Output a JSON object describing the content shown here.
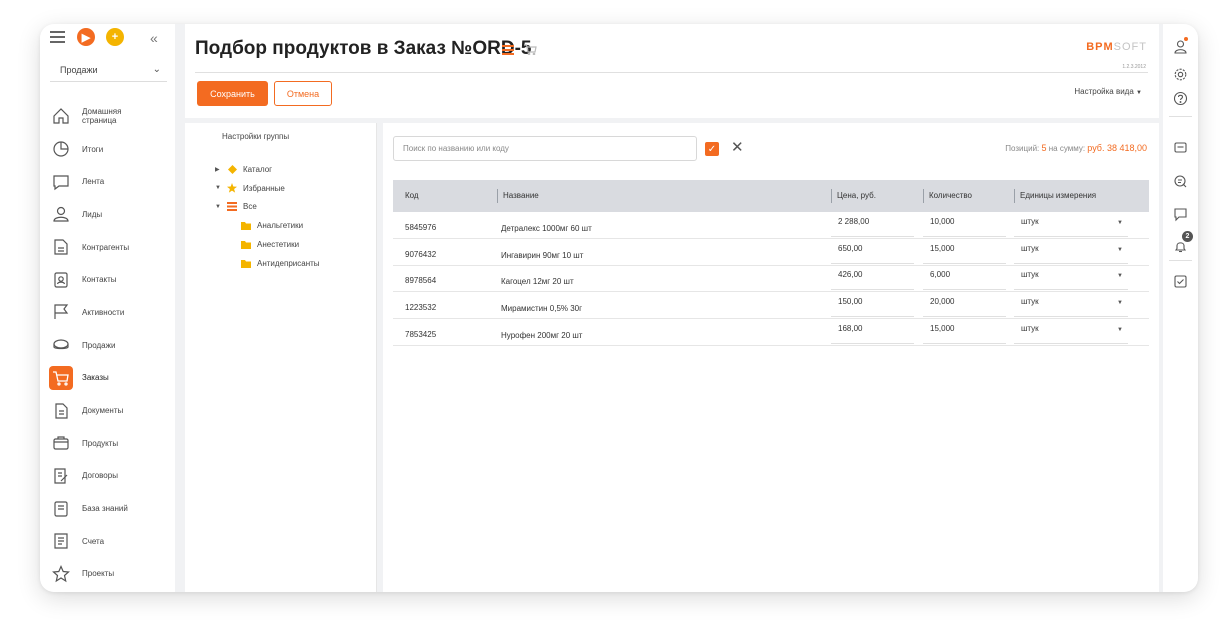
{
  "sidebar": {
    "workspace": "Продажи",
    "items": [
      {
        "label": "Домашняя страница",
        "icon": "home-icon"
      },
      {
        "label": "Итоги",
        "icon": "pie-chart-icon"
      },
      {
        "label": "Лента",
        "icon": "feed-icon"
      },
      {
        "label": "Лиды",
        "icon": "leads-icon"
      },
      {
        "label": "Контрагенты",
        "icon": "accounts-icon"
      },
      {
        "label": "Контакты",
        "icon": "contacts-icon"
      },
      {
        "label": "Активности",
        "icon": "flag-icon"
      },
      {
        "label": "Продажи",
        "icon": "opportunities-icon"
      },
      {
        "label": "Заказы",
        "icon": "cart-icon"
      },
      {
        "label": "Документы",
        "icon": "documents-icon"
      },
      {
        "label": "Продукты",
        "icon": "products-icon"
      },
      {
        "label": "Договоры",
        "icon": "contracts-icon"
      },
      {
        "label": "База знаний",
        "icon": "knowledge-base-icon"
      },
      {
        "label": "Счета",
        "icon": "invoices-icon"
      },
      {
        "label": "Проекты",
        "icon": "star-icon"
      }
    ],
    "active": "Заказы"
  },
  "header": {
    "title": "Подбор продуктов в Заказ №ORD-5",
    "logo_accent": "BPM",
    "logo_rest": "SOFT",
    "version": "1.2.3.2012",
    "save_label": "Сохранить",
    "cancel_label": "Отмена",
    "view_settings": "Настройка вида"
  },
  "groups": {
    "title": "Настройки группы",
    "tree": [
      {
        "label": "Каталог",
        "icon": "diamond-icon",
        "expander": "collapsed"
      },
      {
        "label": "Избранные",
        "icon": "star-icon",
        "expander": "expanded"
      },
      {
        "label": "Все",
        "icon": "list-icon",
        "expander": "expanded"
      },
      {
        "label": "Анальгетики",
        "icon": "folder-icon"
      },
      {
        "label": "Анестетики",
        "icon": "folder-icon"
      },
      {
        "label": "Антидеприсанты",
        "icon": "folder-icon"
      }
    ]
  },
  "main": {
    "search_placeholder": "Поиск по названию или коду",
    "summary_label": "Позиций:",
    "summary_count": "5",
    "summary_mid": "на сумму:",
    "summary_total": "руб. 38 418,00",
    "columns": [
      "Код",
      "Название",
      "Цена, руб.",
      "Количество",
      "Единицы измерения"
    ],
    "rows": [
      {
        "code": "5845976",
        "name": "Детралекс 1000мг 60 шт",
        "price": "2 288,00",
        "qty": "10,000",
        "unit": "штук"
      },
      {
        "code": "9076432",
        "name": "Ингавирин 90мг 10 шт",
        "price": "650,00",
        "qty": "15,000",
        "unit": "штук"
      },
      {
        "code": "8978564",
        "name": "Кагоцел 12мг 20 шт",
        "price": "426,00",
        "qty": "6,000",
        "unit": "штук"
      },
      {
        "code": "1223532",
        "name": "Мирамистин 0,5% 30г",
        "price": "150,00",
        "qty": "20,000",
        "unit": "штук"
      },
      {
        "code": "7853425",
        "name": "Нурофен 200мг 20 шт",
        "price": "168,00",
        "qty": "15,000",
        "unit": "штук"
      }
    ]
  },
  "rightbar": {
    "notifications_count": "2"
  },
  "colors": {
    "accent": "#f36b21",
    "header_row": "#d9dbe0",
    "frame_bg": "#f1f2f4"
  }
}
